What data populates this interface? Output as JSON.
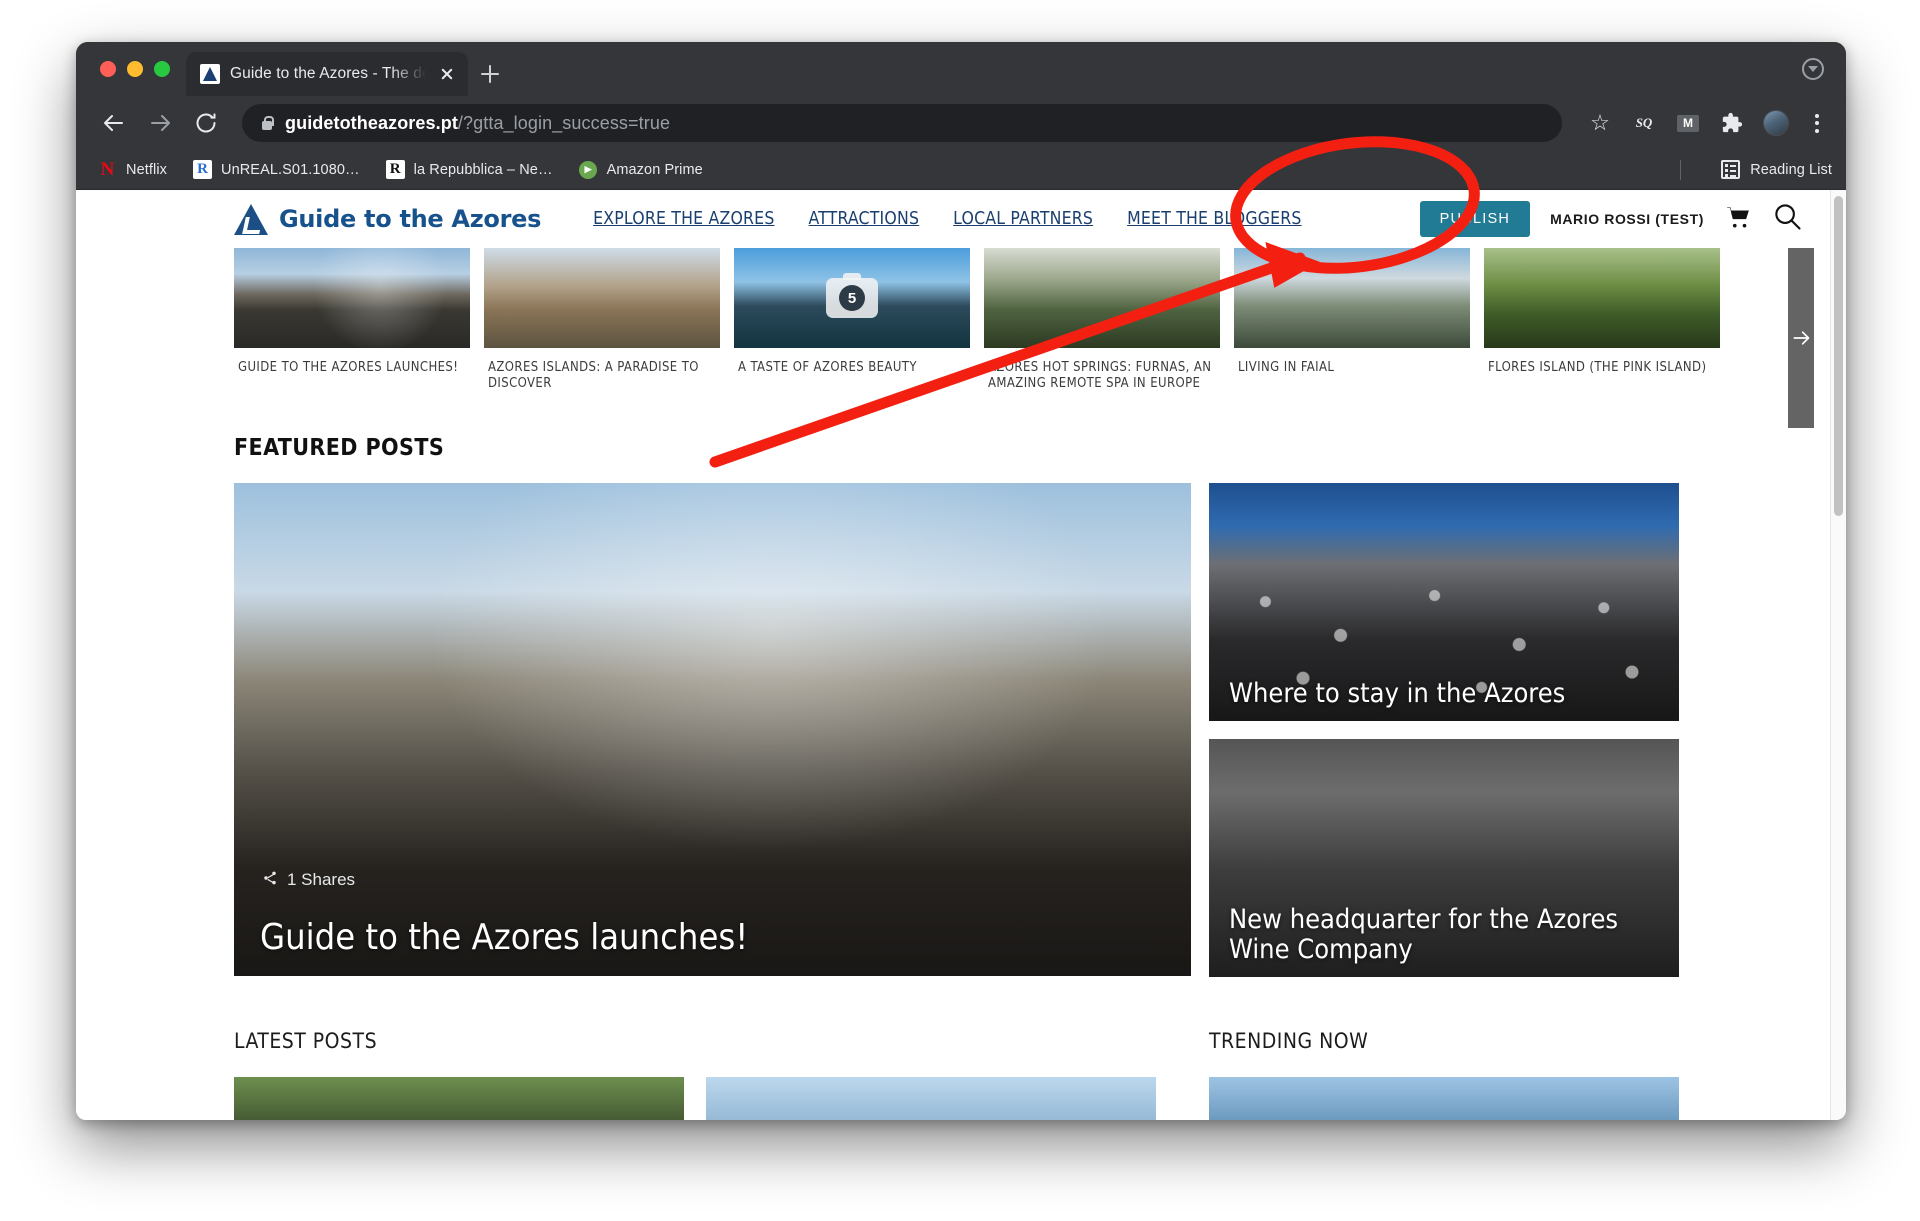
{
  "browser": {
    "tab": {
      "title": "Guide to the Azores - The defin",
      "favicon_icon": "site-logo-icon",
      "close_icon": "close-icon"
    },
    "new_tab_icon": "plus-icon",
    "window_menu_icon": "chevron-down-circle-icon",
    "traffic_lights": [
      "close",
      "minimize",
      "zoom"
    ],
    "nav": {
      "back_icon": "arrow-left-icon",
      "forward_icon": "arrow-right-icon",
      "reload_icon": "reload-icon"
    },
    "omnibox": {
      "lock_icon": "lock-icon",
      "host": "guidetotheazores.pt",
      "path": "/?gtta_login_success=true",
      "full_url": "guidetotheazores.pt/?gtta_login_success=true"
    },
    "toolbar_icons": [
      {
        "name": "bookmark-star-icon",
        "glyph": "☆"
      },
      {
        "name": "sq-extension-icon",
        "glyph": "SQ"
      },
      {
        "name": "gmail-extension-icon",
        "glyph": "M"
      },
      {
        "name": "extensions-puzzle-icon",
        "glyph": "🧩"
      },
      {
        "name": "profile-avatar",
        "glyph": ""
      },
      {
        "name": "chrome-menu-icon",
        "glyph": "⋮"
      }
    ],
    "bookmarks": [
      {
        "label": "Netflix",
        "icon": "netflix-icon",
        "glyph": "N"
      },
      {
        "label": "UnREAL.S01.1080…",
        "icon": "rarbg-icon",
        "glyph": "R"
      },
      {
        "label": "la Repubblica – Ne…",
        "icon": "repubblica-icon",
        "glyph": "R"
      },
      {
        "label": "Amazon Prime",
        "icon": "amazon-prime-icon",
        "glyph": "▶"
      }
    ],
    "reading_list": {
      "label": "Reading List",
      "icon": "reading-list-icon"
    }
  },
  "site": {
    "brand": {
      "name": "Guide to the Azores",
      "logo_icon": "azores-whale-tail-logo"
    },
    "nav_items": [
      {
        "label": "EXPLORE THE AZORES"
      },
      {
        "label": "ATTRACTIONS"
      },
      {
        "label": "LOCAL PARTNERS"
      },
      {
        "label": "MEET THE BLOGGERS"
      }
    ],
    "publish_button": "PUBLISH",
    "user_name": "MARIO ROSSI (TEST)",
    "cart_icon": "shopping-cart-icon",
    "search_icon": "search-icon",
    "carousel": {
      "next_icon": "arrow-right-icon",
      "items": [
        {
          "caption": "GUIDE TO THE AZORES LAUNCHES!",
          "image": "img-gate",
          "badge": null
        },
        {
          "caption": "AZORES ISLANDS: A PARADISE TO DISCOVER",
          "image": "img-cliff",
          "badge": null
        },
        {
          "caption": "A TASTE OF AZORES BEAUTY",
          "image": "img-volcano",
          "badge": "5"
        },
        {
          "caption": "AZORES HOT SPRINGS: FURNAS, AN AMAZING REMOTE SPA IN EUROPE",
          "image": "img-springs",
          "badge": null
        },
        {
          "caption": "LIVING IN FAIAL",
          "image": "img-faial",
          "badge": null
        },
        {
          "caption": "FLORES ISLAND (THE PINK ISLAND)",
          "image": "img-flores",
          "badge": null
        }
      ]
    },
    "featured": {
      "heading": "FEATURED POSTS",
      "hero": {
        "title": "Guide to the Azores launches!",
        "shares": "1 Shares",
        "share_icon": "share-icon",
        "image": "img-hero"
      },
      "side_cards": [
        {
          "title": "Where to stay in the Azores",
          "image": "img-stay"
        },
        {
          "title": "New headquarter for the Azores Wine Company",
          "image": "img-wine"
        }
      ]
    },
    "bottom": {
      "latest_heading": "LATEST POSTS",
      "trending_heading": "TRENDING NOW"
    }
  },
  "annotation": {
    "type": "red-marker",
    "color": "#f32012",
    "shapes": [
      "ellipse-around-publish-and-user",
      "arrow-pointing-to-publish"
    ],
    "target_label": "PUBLISH"
  }
}
